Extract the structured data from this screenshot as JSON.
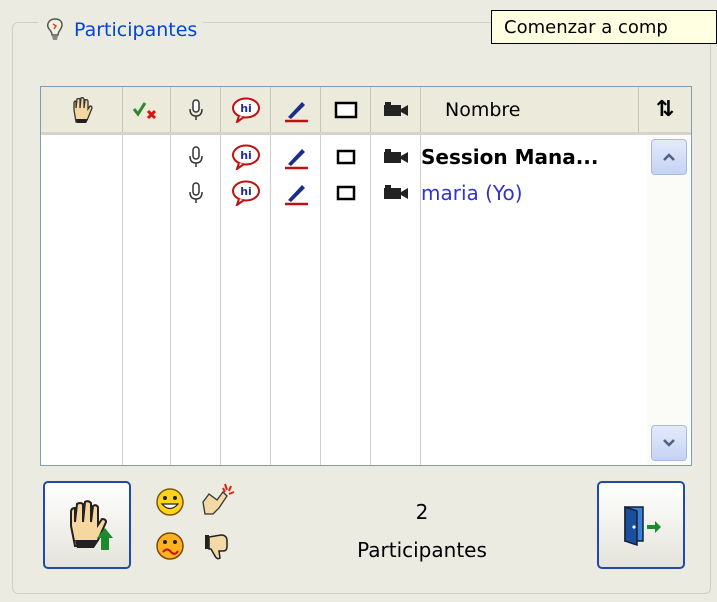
{
  "panel": {
    "title": "Participantes",
    "tooltip": "Comenzar a comp"
  },
  "list": {
    "columns": [
      {
        "icon": "raise-hand-icon"
      },
      {
        "icon": "check-cross-icon"
      },
      {
        "icon": "microphone-icon"
      },
      {
        "icon": "chat-hi-icon"
      },
      {
        "icon": "pen-icon"
      },
      {
        "icon": "whiteboard-icon"
      },
      {
        "icon": "video-camera-icon"
      },
      {
        "label": "Nombre"
      }
    ],
    "sort_icon": "⇅",
    "participants": [
      {
        "name": "Session Mana...",
        "style": "bold"
      },
      {
        "name": "maria (Yo)",
        "style": "self"
      }
    ]
  },
  "footer": {
    "count": "2",
    "count_label": "Participantes"
  },
  "colors": {
    "accent": "#0046d5",
    "self_name": "#3333cc",
    "background": "#ecebe2"
  }
}
